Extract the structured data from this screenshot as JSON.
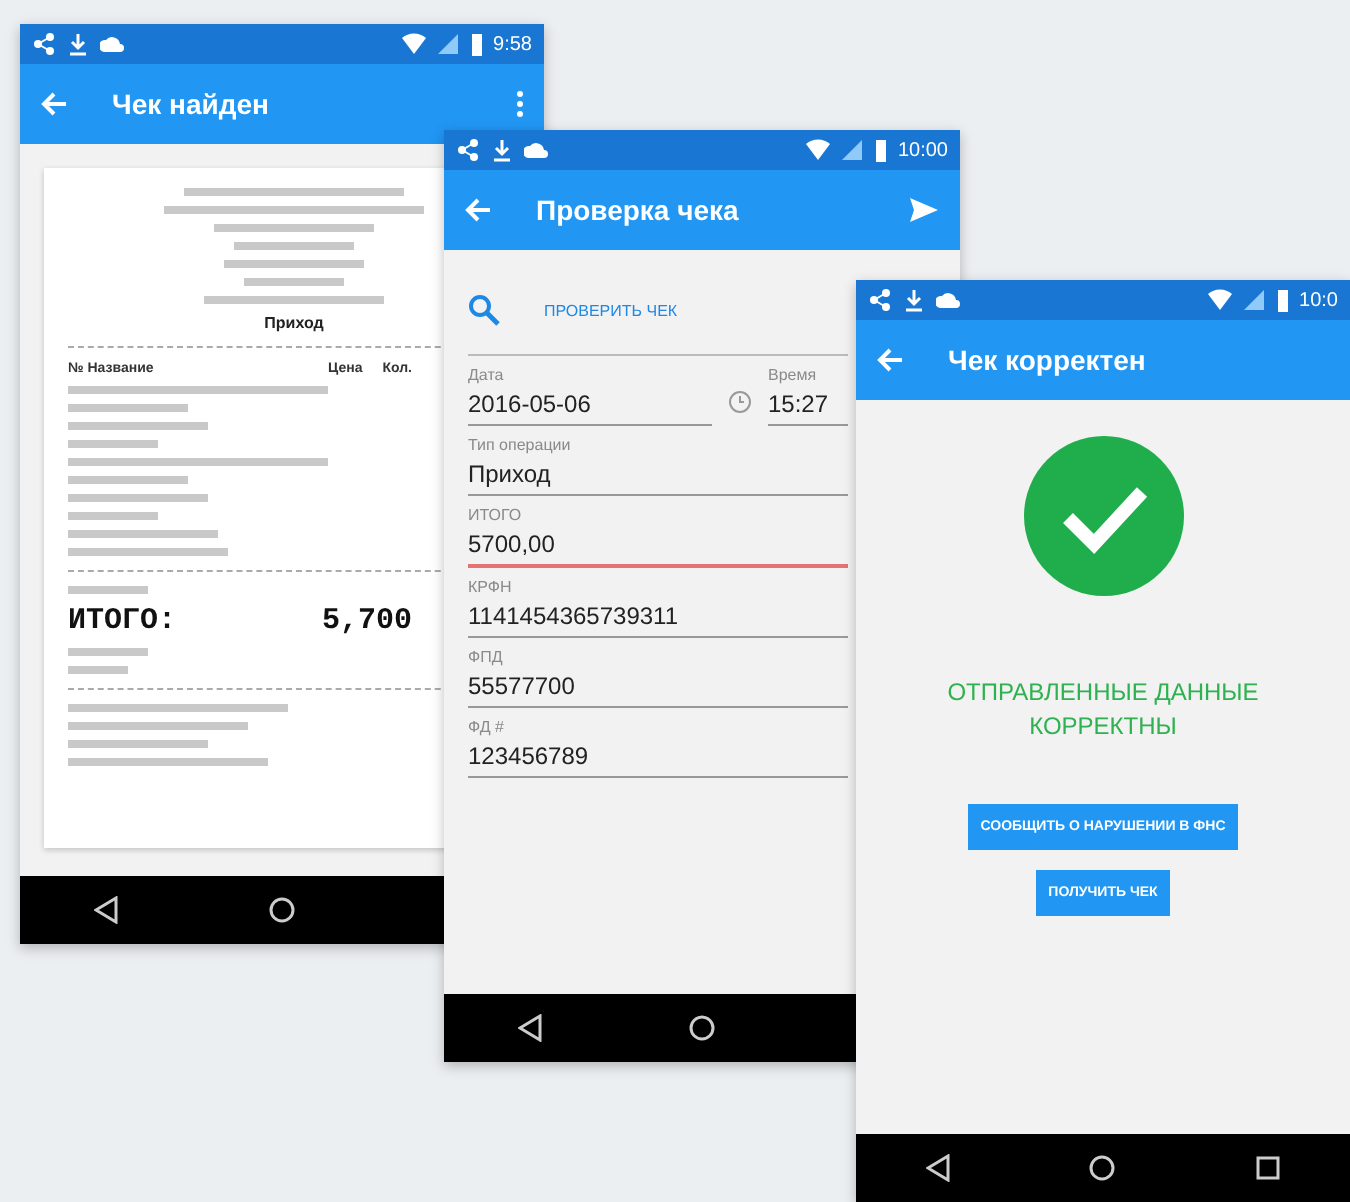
{
  "receipt_screen": {
    "status_time": "9:58",
    "title": "Чек найден",
    "receipt": {
      "operation": "Приход",
      "columns": [
        "№ Название",
        "Цена",
        "Кол."
      ],
      "total_label": "ИТОГО:",
      "total_value": "5,700"
    }
  },
  "check_screen": {
    "status_time": "10:00",
    "title": "Проверка чека",
    "check_link": "ПРОВЕРИТЬ ЧЕК",
    "date": {
      "label": "Дата",
      "value": "2016-05-06"
    },
    "time": {
      "label": "Время",
      "value": "15:27"
    },
    "fields": [
      {
        "label": "Тип операции",
        "value": "Приход",
        "focused": false
      },
      {
        "label": "ИТОГО",
        "value": "5700,00",
        "focused": true
      },
      {
        "label": "КРФН",
        "value": "1141454365739311",
        "focused": false
      },
      {
        "label": "ФПД",
        "value": "55577700",
        "focused": false
      },
      {
        "label": "ФД #",
        "value": "123456789",
        "focused": false
      }
    ]
  },
  "result_screen": {
    "status_time": "10:0",
    "title": "Чек корректен",
    "message": "ОТПРАВЛЕННЫЕ ДАННЫЕ КОРРЕКТНЫ",
    "buttons": [
      "СООБЩИТЬ О НАРУШЕНИИ В ФНС",
      "ПОЛУЧИТЬ ЧЕК"
    ]
  }
}
